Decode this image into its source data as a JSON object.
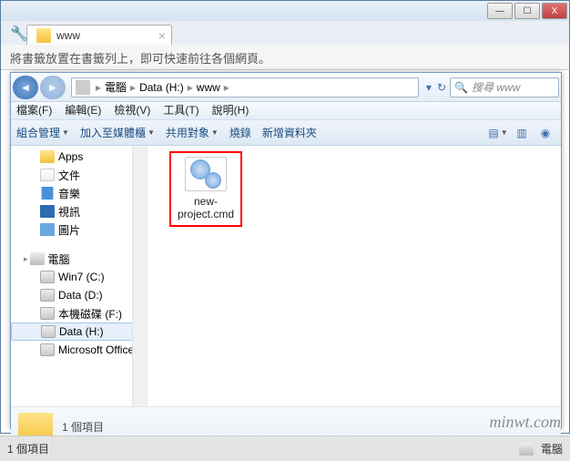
{
  "window": {
    "tab_title": "www",
    "min": "—",
    "max": "☐",
    "close": "X"
  },
  "bookmark_hint": "將書籤放置在書籤列上，即可快速前往各個網頁。",
  "breadcrumb": {
    "root": "電腦",
    "drive": "Data (H:)",
    "folder": "www"
  },
  "search": {
    "placeholder": "搜尋 www"
  },
  "menu": {
    "file": "檔案(F)",
    "edit": "編輯(E)",
    "view": "檢視(V)",
    "tools": "工具(T)",
    "help": "說明(H)"
  },
  "toolbar": {
    "organize": "組合管理",
    "include": "加入至媒體櫃",
    "share": "共用對象",
    "burn": "燒錄",
    "newfolder": "新增資料夾"
  },
  "sidebar": {
    "items": [
      {
        "label": "Apps",
        "icon": "folder-y",
        "indent": true
      },
      {
        "label": "文件",
        "icon": "paper",
        "indent": true
      },
      {
        "label": "音樂",
        "icon": "music",
        "indent": true
      },
      {
        "label": "視訊",
        "icon": "video",
        "indent": true
      },
      {
        "label": "圖片",
        "icon": "pic",
        "indent": true
      }
    ],
    "computer": "電腦",
    "drives": [
      {
        "label": "Win7 (C:)"
      },
      {
        "label": "Data (D:)"
      },
      {
        "label": "本機磁碟 (F:)"
      },
      {
        "label": "Data (H:)",
        "selected": true
      },
      {
        "label": "Microsoft Office"
      }
    ]
  },
  "files": [
    {
      "name": "new-project.cmd"
    }
  ],
  "details": {
    "count": "1 個項目"
  },
  "status": {
    "items": "1 個項目",
    "right": "電腦"
  },
  "watermark": "minwt.com"
}
